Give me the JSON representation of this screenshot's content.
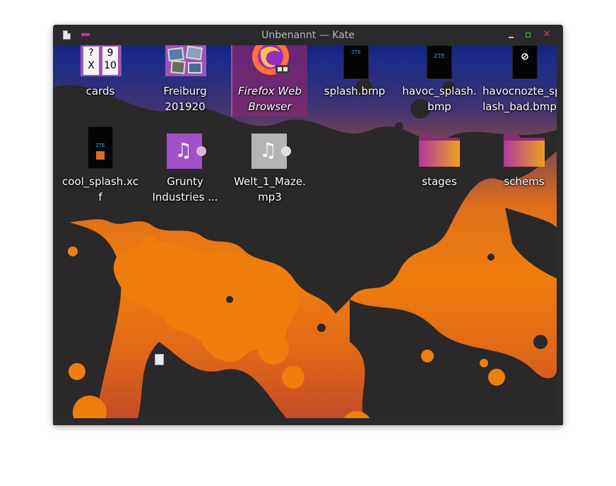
{
  "window": {
    "title": "Unbenannt — Kate",
    "controls": {
      "minimize": "minimize",
      "maximize": "maximize",
      "close": "✕"
    }
  },
  "desktop": {
    "icons": [
      {
        "id": "cards",
        "label": "cards",
        "icon": "playing-cards-thumbnail",
        "texts": [
          "?",
          "9",
          "X",
          "10"
        ]
      },
      {
        "id": "freiburg",
        "label": "Freiburg 201920",
        "icon": "photo-album-thumbnail"
      },
      {
        "id": "firefox",
        "label": "Firefox Web Browser",
        "icon": "firefox-icon",
        "selected": true
      },
      {
        "id": "splash",
        "label": "splash.bmp",
        "icon": "phone-splash-thumbnail",
        "screen_text": "ZTE"
      },
      {
        "id": "havoc_splash",
        "label": "havoc_splash.bmp",
        "icon": "phone-splash-thumbnail",
        "screen_text": "ZTE"
      },
      {
        "id": "havocnozte",
        "label": "havocnozte_splash_bad.bmp",
        "icon": "phone-splash-thumbnail"
      },
      {
        "id": "cool_splash",
        "label": "cool_splash.xcf",
        "icon": "phone-splash-thumbnail",
        "screen_text": "ZTE"
      },
      {
        "id": "grunty",
        "label": "Grunty Industries ...",
        "icon": "music-file-icon",
        "color": "#a050c8"
      },
      {
        "id": "welt",
        "label": "Welt_1_Maze.mp3",
        "icon": "music-file-icon",
        "color": "#b4b4b4"
      },
      {
        "id": "stages",
        "label": "stages",
        "icon": "folder-icon"
      },
      {
        "id": "schems",
        "label": "schems",
        "icon": "folder-icon"
      }
    ]
  },
  "colors": {
    "titlebar": "#2a2a2c",
    "title_text": "#b8b8bb",
    "accent": "#c233b6",
    "minimize": "#d9d23a",
    "maximize": "#3fc444",
    "close": "#e04545",
    "splatter": "#2a2828",
    "selection": "#84286e"
  }
}
